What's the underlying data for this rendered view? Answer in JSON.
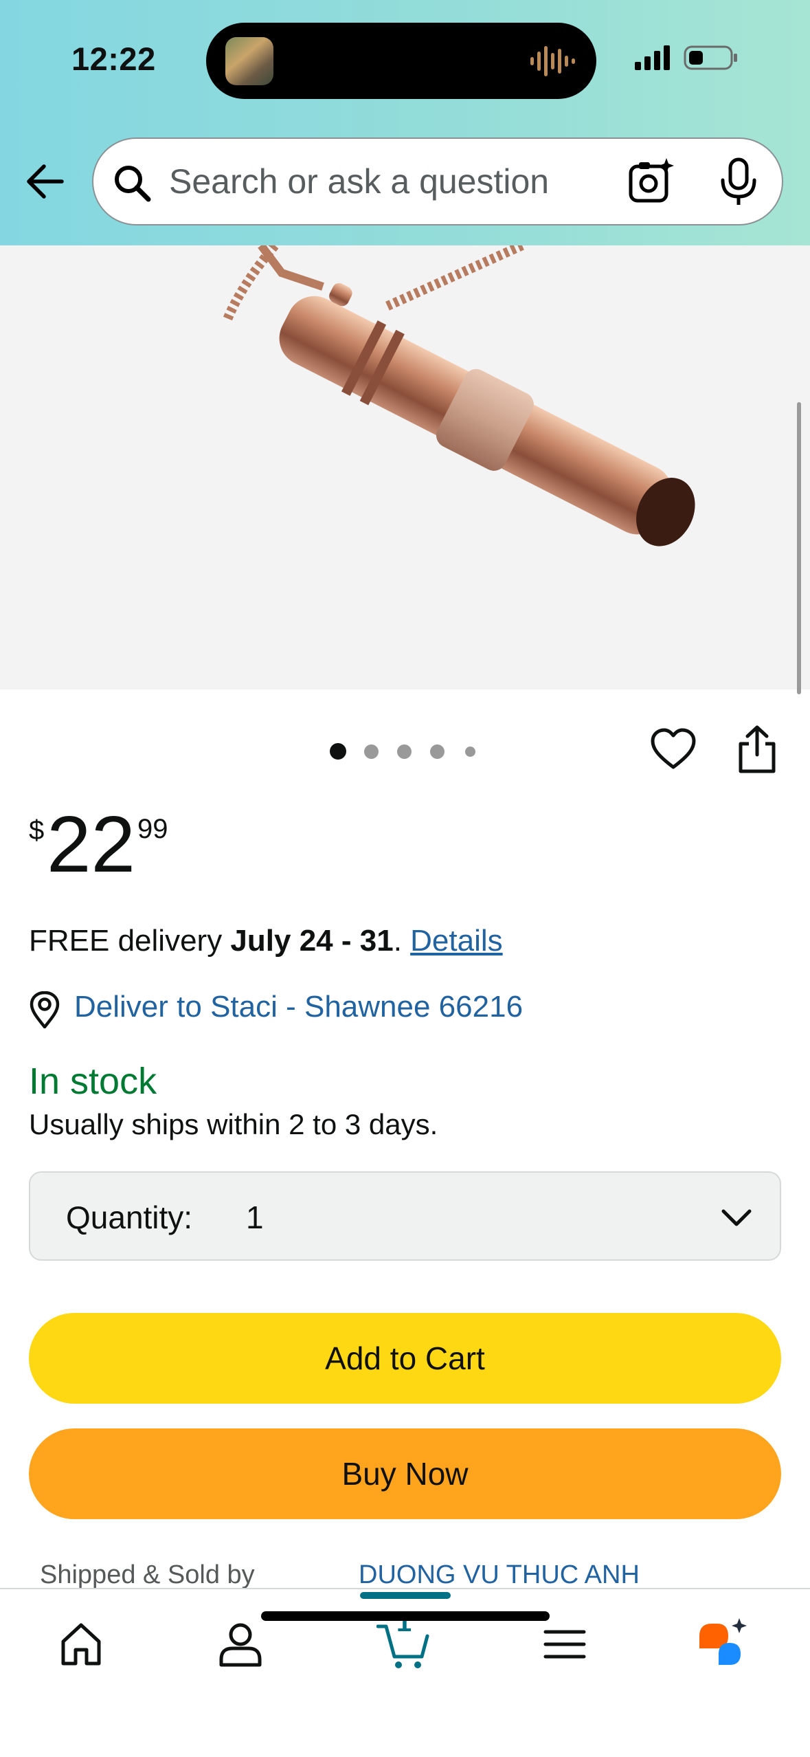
{
  "status_bar": {
    "time": "12:22"
  },
  "search": {
    "placeholder": "Search or ask a question"
  },
  "carousel": {
    "total": 5,
    "active": 1
  },
  "price": {
    "symbol": "$",
    "whole": "22",
    "fraction": "99"
  },
  "delivery": {
    "prefix": "FREE delivery ",
    "dates": "July 24 - 31",
    "separator": ". ",
    "details_link": "Details",
    "deliver_to": "Deliver to Staci - Shawnee 66216"
  },
  "availability": {
    "status": "In stock",
    "ships": "Usually ships within 2 to 3 days."
  },
  "quantity": {
    "label": "Quantity:",
    "value": "1"
  },
  "buttons": {
    "add_to_cart": "Add to Cart",
    "buy_now": "Buy Now"
  },
  "seller": {
    "label": "Shipped & Sold by",
    "name": "DUONG VU THUC ANH"
  },
  "tabbar": {
    "cart_count": "1",
    "items": [
      "home-icon",
      "account-icon",
      "cart-icon",
      "menu-icon",
      "rufus-icon"
    ],
    "active": "cart"
  },
  "colors": {
    "add_to_cart": "#ffd814",
    "buy_now": "#ffa41c",
    "link": "#2162a1",
    "in_stock": "#007a33",
    "cart_accent": "#007185"
  }
}
